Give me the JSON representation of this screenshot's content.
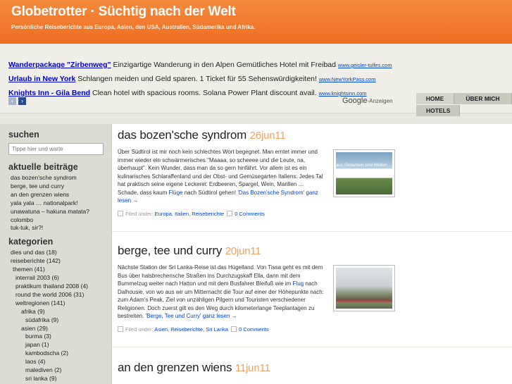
{
  "header": {
    "title": "Globetrotter · Süchtig nach der Welt",
    "description": "Persönliche Reiseberichte aus Europa, Asien, den USA, Australien, Südamerika und Afrika."
  },
  "ads": [
    {
      "title": "Wanderpackage \"Zirbenweg\"",
      "text": " Einzigartige Wanderung in den Alpen Gemütliches Hotel mit Freibad ",
      "url": "www.geisler-tulfes.com"
    },
    {
      "title": "Urlaub in New York",
      "text": " Schlangen meiden und Geld sparen. 1 Ticket für 55 Sehenswürdigkeiten! ",
      "url": "www.NewYorkPass.com"
    },
    {
      "title": "Knights Inn - Gila Bend",
      "text": " Clean hotel with spacious rooms. Solana Power Plant discount avail. ",
      "url": "www.knightsinn.com"
    }
  ],
  "adnav": {
    "prev": "‹",
    "next": "›"
  },
  "google": {
    "brand": "Google",
    "label": "-Anzeigen"
  },
  "nav": {
    "home": "HOME",
    "about": "ÜBER MICH",
    "hotels": "HOTELS"
  },
  "sidebar": {
    "search_heading": "suchen",
    "search_placeholder": "Tippe hier und warte",
    "recent_heading": "aktuelle beiträge",
    "recent": [
      "das bozen'sche syndrom",
      "berge, tee und curry",
      "an den grenzen wiens",
      "yala yala … nationalpark!",
      "unawatuna – hakuna matata?",
      "colombo",
      "tuk-tuk, sir?!"
    ],
    "categories_heading": "kategorien",
    "categories": [
      {
        "label": "dies und das (18)",
        "level": 1
      },
      {
        "label": "reiseberichte (142)",
        "level": 1
      },
      {
        "label": "themen (41)",
        "level": 2
      },
      {
        "label": "interrail 2003 (6)",
        "level": 3
      },
      {
        "label": "praktikum thailand 2008 (4)",
        "level": 3
      },
      {
        "label": "round the world 2006 (31)",
        "level": 3
      },
      {
        "label": "weltregionen (141)",
        "level": 3
      },
      {
        "label": "afrika (9)",
        "level": 4
      },
      {
        "label": "südafrika (9)",
        "level": 5
      },
      {
        "label": "asien (29)",
        "level": 4
      },
      {
        "label": "burma (3)",
        "level": 5
      },
      {
        "label": "japan (1)",
        "level": 5
      },
      {
        "label": "kambodscha (2)",
        "level": 5
      },
      {
        "label": "laos (4)",
        "level": 5
      },
      {
        "label": "malediven (2)",
        "level": 5
      },
      {
        "label": "sri lanka (9)",
        "level": 5
      }
    ]
  },
  "posts": [
    {
      "title": "das bozen'sche syndrom",
      "date": "26jun11",
      "text": "Über Südtirol ist mir noch kein schlechtes Wort begegnet. Man erntet immer und immer wieder ein schwärmerisches \"Maaaa, so scheeee und die Leute, na, überhaupt\". Kein Wunder, dass man da so gern hinfährt. Vor allem ist es ein kulinarisches Schlaraffenland und der Obst- und Gemüsegarten Italiens. Jedes Tal hat praktisch seine eigene Leckerei: Erdbeeren, Spargel, Wein, Marillen … Schade, dass kaum ",
      "link1": "Flüge",
      "text2": " nach Südtirol gehen! ",
      "more": "'Das Bozen'sche Syndrom' ganz lesen →",
      "image_caption": "aus Gedanken sind Welten … sola il pensiero vola",
      "filed_label": "Filed under: ",
      "categories": "Europa, Italien, Reiseberichte",
      "comments": "0 Comments"
    },
    {
      "title": "berge, tee und curry",
      "date": "20jun11",
      "text": "Nächste Station der Sri Lanka-Reise ist das Hügelland. Von Tissa geht es mit dem Bus über halsbrecherische Straßen ins Durchzugskaff Ella, dann mit dem Bummelzug weiter nach Hatton und mit dem Busfahrer Bleifuß wie im ",
      "link1": "Flug",
      "text2": " nach Dalhousie, von wo aus wir um Mitternacht die Tour auf einer der Höhepunkte nach: zum Adam's Peak, Ziel von unzähligen Pilgern und Touristen verschiedener Religionen. Doch zuerst gilt es den Weg durch kilometerlange Teeplantagen zu bestreiten. ",
      "more": "'Berge, Tee und Curry' ganz lesen →",
      "filed_label": "Filed under: ",
      "categories": "Asien, Reiseberichte, Sri Lanka",
      "comments": "0 Comments"
    },
    {
      "title": "an den grenzen wiens",
      "date": "11jun11"
    }
  ]
}
